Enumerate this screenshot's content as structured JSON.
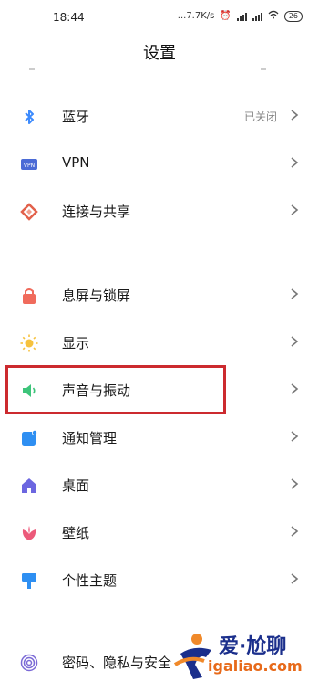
{
  "status_bar": {
    "time": "18:44",
    "speed": "...7.7K/s",
    "battery": "26"
  },
  "header": {
    "title": "设置"
  },
  "items": [
    {
      "label": "蓝牙",
      "value": "已关闭",
      "icon": "bluetooth-icon",
      "color": "#3d8bfd"
    },
    {
      "label": "VPN",
      "icon": "vpn-icon",
      "color": "#4b6bd6"
    },
    {
      "label": "连接与共享",
      "icon": "connection-share-icon",
      "color": "#e2614b"
    },
    {
      "label": "息屏与锁屏",
      "icon": "lock-icon",
      "color": "#f06b5c"
    },
    {
      "label": "显示",
      "icon": "sun-icon",
      "color": "#f6c23e"
    },
    {
      "label": "声音与振动",
      "icon": "speaker-icon",
      "color": "#3dc47a"
    },
    {
      "label": "通知管理",
      "icon": "notification-icon",
      "color": "#2e8ff2"
    },
    {
      "label": "桌面",
      "icon": "home-icon",
      "color": "#6c66e0"
    },
    {
      "label": "壁纸",
      "icon": "flower-icon",
      "color": "#ec5a7a"
    },
    {
      "label": "个性主题",
      "icon": "theme-brush-icon",
      "color": "#2e8ff2"
    },
    {
      "label": "密码、隐私与安全",
      "icon": "fingerprint-icon",
      "color": "#7b6ad6"
    }
  ],
  "highlight": {
    "color": "#cc2a2f"
  },
  "watermark": {
    "line1": "爱·尬聊",
    "line2": "igaliao.com"
  }
}
